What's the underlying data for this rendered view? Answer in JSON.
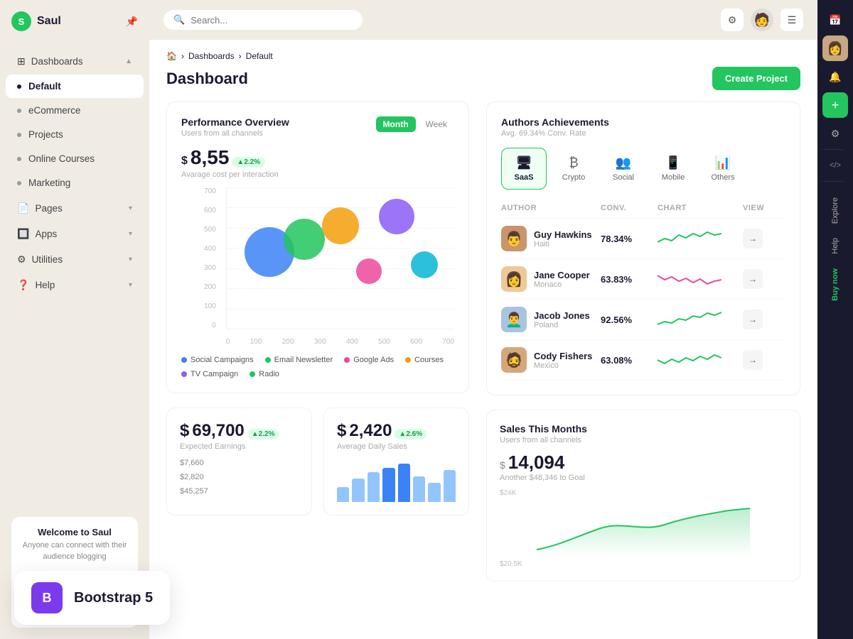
{
  "app": {
    "name": "Saul",
    "logo_letter": "S"
  },
  "sidebar": {
    "sections": [
      {
        "items": [
          {
            "id": "dashboards",
            "label": "Dashboards",
            "icon": "⊞",
            "has_chevron": true,
            "active": false
          },
          {
            "id": "default",
            "label": "Default",
            "dot": true,
            "active": true
          },
          {
            "id": "ecommerce",
            "label": "eCommerce",
            "dot": true,
            "active": false
          },
          {
            "id": "projects",
            "label": "Projects",
            "dot": true,
            "active": false
          },
          {
            "id": "online-courses",
            "label": "Online Courses",
            "dot": true,
            "active": false
          },
          {
            "id": "marketing",
            "label": "Marketing",
            "dot": true,
            "active": false
          }
        ]
      },
      {
        "items": [
          {
            "id": "pages",
            "label": "Pages",
            "icon": "📄",
            "has_chevron": true,
            "active": false
          },
          {
            "id": "apps",
            "label": "Apps",
            "icon": "🔲",
            "has_chevron": true,
            "active": false
          },
          {
            "id": "utilities",
            "label": "Utilities",
            "icon": "⚙",
            "has_chevron": true,
            "active": false
          },
          {
            "id": "help",
            "label": "Help",
            "icon": "❓",
            "has_chevron": true,
            "active": false
          }
        ]
      }
    ],
    "welcome": {
      "title": "Welcome to Saul",
      "subtitle": "Anyone can connect with their audience blogging"
    }
  },
  "topbar": {
    "search_placeholder": "Search...",
    "search_label": "Search _"
  },
  "breadcrumb": {
    "home": "🏠",
    "items": [
      "Dashboards",
      "Default"
    ]
  },
  "page": {
    "title": "Dashboard",
    "create_button": "Create Project"
  },
  "performance": {
    "title": "Performance Overview",
    "subtitle": "Users from all channels",
    "tabs": [
      "Month",
      "Week"
    ],
    "active_tab": "Month",
    "metric_value": "8,55",
    "metric_currency": "$",
    "metric_badge": "▲2.2%",
    "metric_label": "Avarage cost per interaction",
    "y_axis": [
      "700",
      "600",
      "500",
      "400",
      "300",
      "200",
      "100",
      "0"
    ],
    "x_axis": [
      "0",
      "100",
      "200",
      "300",
      "400",
      "500",
      "600",
      "700"
    ],
    "bubbles": [
      {
        "color": "#3b82f6",
        "size": 70,
        "x": 22,
        "y": 38,
        "left": "10%",
        "top": "30%"
      },
      {
        "color": "#22c55e",
        "size": 58,
        "x": 28,
        "y": 30,
        "left": "27%",
        "top": "25%"
      },
      {
        "color": "#f59e0b",
        "size": 52,
        "x": 38,
        "y": 22,
        "left": "43%",
        "top": "18%"
      },
      {
        "color": "#ec4899",
        "size": 36,
        "x": 48,
        "y": 40,
        "left": "57%",
        "top": "48%"
      },
      {
        "color": "#8b5cf6",
        "size": 50,
        "x": 55,
        "y": 20,
        "left": "67%",
        "top": "10%"
      },
      {
        "color": "#06b6d4",
        "size": 38,
        "x": 65,
        "y": 40,
        "left": "80%",
        "top": "45%"
      }
    ],
    "legend": [
      {
        "label": "Social Campaigns",
        "color": "#3b82f6"
      },
      {
        "label": "Email Newsletter",
        "color": "#22c55e"
      },
      {
        "label": "Google Ads",
        "color": "#ec4899"
      },
      {
        "label": "Courses",
        "color": "#f59e0b"
      },
      {
        "label": "TV Campaign",
        "color": "#8b5cf6"
      },
      {
        "label": "Radio",
        "color": "#22c55e"
      }
    ]
  },
  "authors": {
    "title": "Authors Achievements",
    "subtitle": "Avg. 69.34% Conv. Rate",
    "tabs": [
      {
        "id": "saas",
        "label": "SaaS",
        "icon": "🖥",
        "active": true
      },
      {
        "id": "crypto",
        "label": "Crypto",
        "icon": "₿",
        "active": false
      },
      {
        "id": "social",
        "label": "Social",
        "icon": "👥",
        "active": false
      },
      {
        "id": "mobile",
        "label": "Mobile",
        "icon": "📱",
        "active": false
      },
      {
        "id": "others",
        "label": "Others",
        "icon": "📊",
        "active": false
      }
    ],
    "table_headers": [
      "AUTHOR",
      "CONV.",
      "CHART",
      "VIEW"
    ],
    "rows": [
      {
        "name": "Guy Hawkins",
        "location": "Haiti",
        "conv": "78.34%",
        "chart_color": "#22c55e",
        "avatar": "👨"
      },
      {
        "name": "Jane Cooper",
        "location": "Monaco",
        "conv": "63.83%",
        "chart_color": "#ec4899",
        "avatar": "👩"
      },
      {
        "name": "Jacob Jones",
        "location": "Poland",
        "conv": "92.56%",
        "chart_color": "#22c55e",
        "avatar": "👨‍🦱"
      },
      {
        "name": "Cody Fishers",
        "location": "Mexico",
        "conv": "63.08%",
        "chart_color": "#22c55e",
        "avatar": "🧔"
      }
    ]
  },
  "stats": [
    {
      "currency": "$",
      "value": "69,700",
      "badge": "▲2.2%",
      "label": "Expected Earnings",
      "bar_values": [
        "$7,660",
        "$2,820",
        "$45,257"
      ]
    },
    {
      "currency": "$",
      "value": "2,420",
      "badge": "▲2.6%",
      "label": "Average Daily Sales"
    }
  ],
  "sales": {
    "title": "Sales This Months",
    "subtitle": "Users from all channels",
    "value": "14,094",
    "currency": "$",
    "goal_text": "Another $48,346 to Goal",
    "y_axis": [
      "$24K",
      "$20.5K"
    ]
  },
  "right_toolbar": {
    "buttons": [
      {
        "id": "calendar",
        "icon": "📅"
      },
      {
        "id": "bell",
        "icon": "🔔"
      },
      {
        "id": "globe",
        "icon": "🌐"
      },
      {
        "id": "code",
        "icon": "<>"
      }
    ],
    "labels": [
      "Explore",
      "Help",
      "Buy now"
    ]
  },
  "bootstrap_badge": {
    "icon": "B",
    "text": "Bootstrap 5"
  }
}
